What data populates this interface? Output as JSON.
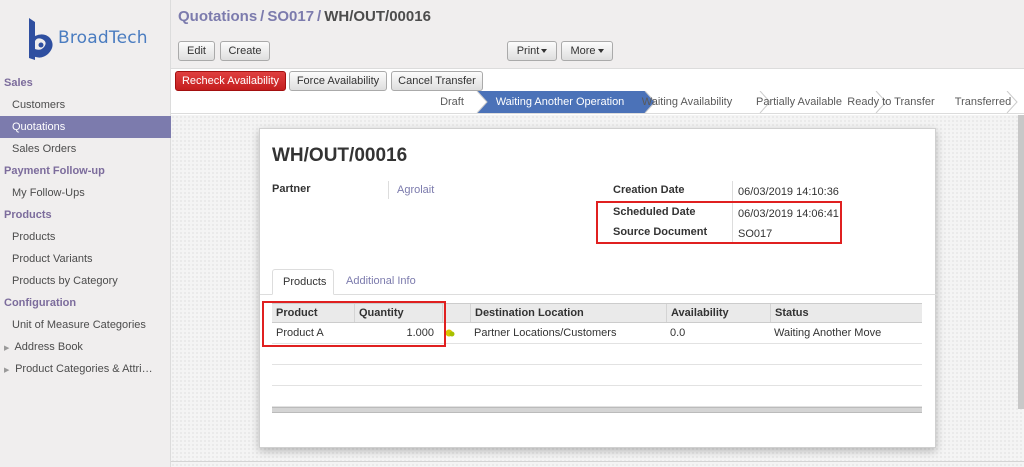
{
  "brand": {
    "name": "BroadTech",
    "logo_color": "#4a7cc0"
  },
  "sidebar": {
    "sections": [
      {
        "title": "Sales",
        "items": [
          {
            "label": "Customers",
            "active": false
          },
          {
            "label": "Quotations",
            "active": true
          },
          {
            "label": "Sales Orders",
            "active": false
          }
        ]
      },
      {
        "title": "Payment Follow-up",
        "items": [
          {
            "label": "My Follow-Ups",
            "active": false
          }
        ]
      },
      {
        "title": "Products",
        "items": [
          {
            "label": "Products",
            "active": false
          },
          {
            "label": "Product Variants",
            "active": false
          },
          {
            "label": "Products by Category",
            "active": false
          }
        ]
      },
      {
        "title": "Configuration",
        "items": [
          {
            "label": "Unit of Measure Categories",
            "active": false
          },
          {
            "label": "Address Book",
            "active": false,
            "collapsible": true
          },
          {
            "label": "Product Categories & Attri…",
            "active": false,
            "collapsible": true
          }
        ]
      }
    ]
  },
  "breadcrumb": {
    "part1": "Quotations",
    "sep1": "/",
    "part2": "SO017",
    "sep2": "/",
    "current": "WH/OUT/00016"
  },
  "toolbar": {
    "edit": "Edit",
    "create": "Create",
    "print": "Print",
    "more": "More"
  },
  "actions": {
    "recheck": "Recheck Availability",
    "force": "Force Availability",
    "cancel": "Cancel Transfer"
  },
  "stages": [
    {
      "label": "Draft",
      "active": false
    },
    {
      "label": "Waiting Another Operation",
      "active": true
    },
    {
      "label": "Waiting Availability",
      "active": false
    },
    {
      "label": "Partially Available",
      "active": false
    },
    {
      "label": "Ready to Transfer",
      "active": false
    },
    {
      "label": "Transferred",
      "active": false
    }
  ],
  "record": {
    "title": "WH/OUT/00016",
    "partner_label": "Partner",
    "partner_value": "Agrolait",
    "creation_date_label": "Creation Date",
    "creation_date_value": "06/03/2019 14:10:36",
    "scheduled_date_label": "Scheduled Date",
    "scheduled_date_value": "06/03/2019 14:06:41",
    "source_document_label": "Source Document",
    "source_document_value": "SO017"
  },
  "tabs": [
    {
      "label": "Products",
      "active": true
    },
    {
      "label": "Additional Info",
      "active": false
    }
  ],
  "table": {
    "columns": [
      "Product",
      "Quantity",
      "",
      "Destination Location",
      "Availability",
      "Status"
    ],
    "rows": [
      {
        "product": "Product A",
        "quantity": "1.000",
        "status_icon": "yellow-ball-icon",
        "destination": "Partner Locations/Customers",
        "availability": "0.0",
        "status": "Waiting Another Move"
      }
    ]
  },
  "colors": {
    "accent": "#7c7bad",
    "active_stage": "#4b72b8",
    "primary_button": "#c41d1d",
    "highlight_box": "#e02020"
  }
}
